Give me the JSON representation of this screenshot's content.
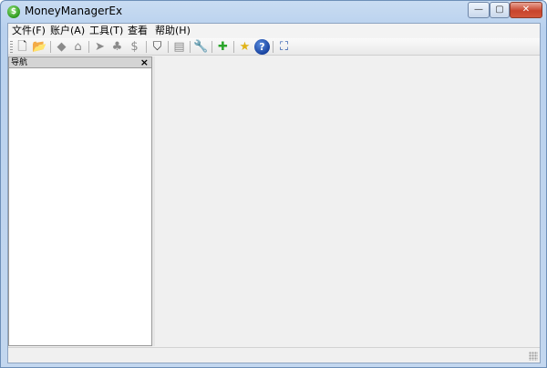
{
  "window": {
    "title": "MoneyManagerEx",
    "app_icon_glyph": "$"
  },
  "window_controls": {
    "minimize": "—",
    "maximize": "▢",
    "close": "✕"
  },
  "menu": [
    {
      "label": "文件(F)"
    },
    {
      "label": "账户(A)"
    },
    {
      "label": "工具(T)"
    },
    {
      "label": "查看"
    },
    {
      "label": "帮助(H)"
    }
  ],
  "toolbar": {
    "buttons": [
      {
        "icon": "new-database-icon",
        "glyph": "🗋",
        "color": "#444444"
      },
      {
        "icon": "open-database-icon",
        "glyph": "📂",
        "color": "#d79b1c"
      },
      {
        "icon": "new-account-icon",
        "glyph": "◆",
        "color": "#8a8a8a"
      },
      {
        "icon": "home-icon",
        "glyph": "⌂",
        "color": "#8a8a8a"
      },
      {
        "icon": "payees-icon",
        "glyph": "➤",
        "color": "#8a8a8a"
      },
      {
        "icon": "categories-icon",
        "glyph": "♣",
        "color": "#8a8a8a"
      },
      {
        "icon": "currency-icon",
        "glyph": "$",
        "color": "#8a8a8a"
      },
      {
        "icon": "filter-icon",
        "glyph": "⛉",
        "color": "#333333"
      },
      {
        "icon": "report-icon",
        "glyph": "▤",
        "color": "#8a8a8a"
      },
      {
        "icon": "options-wrench-icon",
        "glyph": "🔧",
        "color": "#6f8fb5"
      },
      {
        "icon": "add-transaction-icon",
        "glyph": "✚",
        "color": "#2aa52a"
      },
      {
        "icon": "favorite-star-icon",
        "glyph": "★",
        "color": "#e0b318"
      },
      {
        "icon": "help-icon",
        "glyph": "?",
        "color": "#ffffff"
      },
      {
        "icon": "fullscreen-icon",
        "glyph": "⛶",
        "color": "#1f4fa8"
      }
    ]
  },
  "navigation": {
    "title": "导航",
    "close_glyph": "×"
  }
}
